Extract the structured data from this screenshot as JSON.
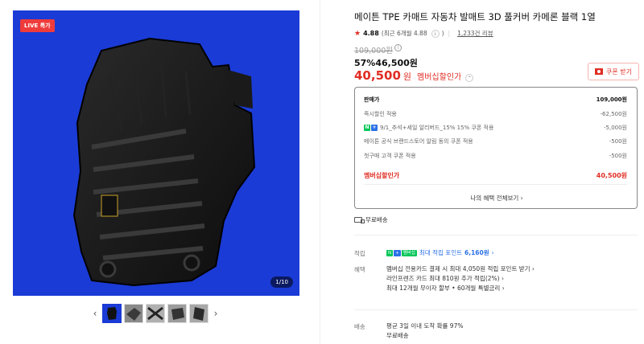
{
  "gallery": {
    "live_badge": "LIVE 특가",
    "counter": "1/10",
    "prev_icon": "chevron-left-icon",
    "next_icon": "chevron-right-icon",
    "accent_color": "#1a3bd6"
  },
  "product": {
    "title": "메이튼 TPE 카매트 자동차 발매트 3D 풀커버 카메론 블랙 1열",
    "rating": "4.88",
    "rating_detail": "(최근 6개월 4.88",
    "review_count": "1,233건 리뷰",
    "original_price": "109,000원",
    "discount_row": "57%46,500원",
    "member_price": "40,500",
    "member_price_unit": "원",
    "member_label": "멤버십할인가",
    "coupon_button": "쿠폰 받기"
  },
  "price_box": {
    "rows": [
      {
        "label": "판매가",
        "value": "109,000원"
      },
      {
        "label": "즉시할인 적용",
        "value": "-62,500원"
      },
      {
        "label": "9/1_추석+세일 알리버드_15% 15% 쿠폰 적용",
        "value": "-5,000원"
      },
      {
        "label": "메이튼 공식 브랜드스토어 알림 동의 쿠폰 적용",
        "value": "-500원"
      },
      {
        "label": "첫구매 고객 쿠폰 적용",
        "value": "-500원"
      }
    ],
    "total_label": "멤버십할인가",
    "total_value": "40,500원",
    "more_label": "나의 혜택 전체보기 ›"
  },
  "shipping_badge": "무료배송",
  "accumulate": {
    "label": "적립",
    "text": "최대 적립 포인트",
    "points": "6,160원",
    "badge_n": "N",
    "badge_plus": "+",
    "badge_mem": "멤버십"
  },
  "benefits": {
    "label": "혜택",
    "lines": [
      "멤버십 전용카드 결제 시 최대 4,050원 적립 포인트 받기 ›",
      "라인프렌즈 카드 최대 810원 추가 적립(2%) ›",
      "최대 12개월 무이자 할부 • 60개월 특별금리 ›"
    ]
  },
  "delivery": {
    "label": "배송",
    "line1": "평균 3일 이내 도착 확률 97%",
    "line2": "무료배송"
  }
}
